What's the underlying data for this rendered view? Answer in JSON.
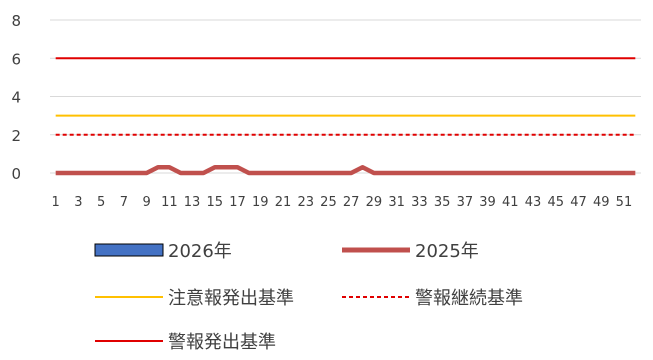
{
  "chart_data": {
    "type": "line",
    "title": "",
    "xlabel": "",
    "ylabel": "",
    "x": [
      1,
      2,
      3,
      4,
      5,
      6,
      7,
      8,
      9,
      10,
      11,
      12,
      13,
      14,
      15,
      16,
      17,
      18,
      19,
      20,
      21,
      22,
      23,
      24,
      25,
      26,
      27,
      28,
      29,
      30,
      31,
      32,
      33,
      34,
      35,
      36,
      37,
      38,
      39,
      40,
      41,
      42,
      43,
      44,
      45,
      46,
      47,
      48,
      49,
      50,
      51,
      52
    ],
    "x_tick_labels": [
      "1",
      "3",
      "5",
      "7",
      "9",
      "11",
      "13",
      "15",
      "17",
      "19",
      "21",
      "23",
      "25",
      "27",
      "29",
      "31",
      "33",
      "35",
      "37",
      "39",
      "41",
      "43",
      "45",
      "47",
      "49",
      "51"
    ],
    "ylim": [
      0,
      8
    ],
    "y_ticks": [
      0,
      2,
      4,
      6,
      8
    ],
    "grid": true,
    "legend_position": "bottom",
    "series": [
      {
        "name": "2026年",
        "style": "bar",
        "color": "#4472C4",
        "values": []
      },
      {
        "name": "2025年",
        "style": "thick-line",
        "color": "#C0504D",
        "values": [
          0,
          0,
          0,
          0,
          0,
          0,
          0,
          0,
          0,
          0.3,
          0.3,
          0,
          0,
          0,
          0.3,
          0.3,
          0.3,
          0,
          0,
          0,
          0,
          0,
          0,
          0,
          0,
          0,
          0,
          0.3,
          0,
          0,
          0,
          0,
          0,
          0,
          0,
          0,
          0,
          0,
          0,
          0,
          0,
          0,
          0,
          0,
          0,
          0,
          0,
          0,
          0,
          0,
          0,
          0
        ]
      },
      {
        "name": "注意報発出基準",
        "style": "line",
        "color": "#FFC000",
        "values": [
          3,
          3,
          3,
          3,
          3,
          3,
          3,
          3,
          3,
          3,
          3,
          3,
          3,
          3,
          3,
          3,
          3,
          3,
          3,
          3,
          3,
          3,
          3,
          3,
          3,
          3,
          3,
          3,
          3,
          3,
          3,
          3,
          3,
          3,
          3,
          3,
          3,
          3,
          3,
          3,
          3,
          3,
          3,
          3,
          3,
          3,
          3,
          3,
          3,
          3,
          3,
          3
        ]
      },
      {
        "name": "警報継続基準",
        "style": "dashed",
        "color": "#E00000",
        "values": [
          2,
          2,
          2,
          2,
          2,
          2,
          2,
          2,
          2,
          2,
          2,
          2,
          2,
          2,
          2,
          2,
          2,
          2,
          2,
          2,
          2,
          2,
          2,
          2,
          2,
          2,
          2,
          2,
          2,
          2,
          2,
          2,
          2,
          2,
          2,
          2,
          2,
          2,
          2,
          2,
          2,
          2,
          2,
          2,
          2,
          2,
          2,
          2,
          2,
          2,
          2,
          2
        ]
      },
      {
        "name": "警報発出基準",
        "style": "line",
        "color": "#E00000",
        "values": [
          6,
          6,
          6,
          6,
          6,
          6,
          6,
          6,
          6,
          6,
          6,
          6,
          6,
          6,
          6,
          6,
          6,
          6,
          6,
          6,
          6,
          6,
          6,
          6,
          6,
          6,
          6,
          6,
          6,
          6,
          6,
          6,
          6,
          6,
          6,
          6,
          6,
          6,
          6,
          6,
          6,
          6,
          6,
          6,
          6,
          6,
          6,
          6,
          6,
          6,
          6,
          6
        ]
      }
    ]
  }
}
